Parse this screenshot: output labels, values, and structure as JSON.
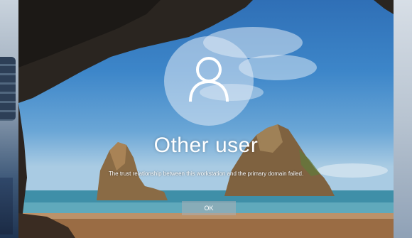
{
  "login": {
    "username": "Other user",
    "error_message": "The trust relationship between this workstation and the primary domain failed.",
    "ok_label": "OK"
  },
  "icons": {
    "avatar": "user-silhouette-icon"
  },
  "colors": {
    "text": "#ffffff",
    "button_bg": "rgba(170,175,180,0.55)"
  }
}
